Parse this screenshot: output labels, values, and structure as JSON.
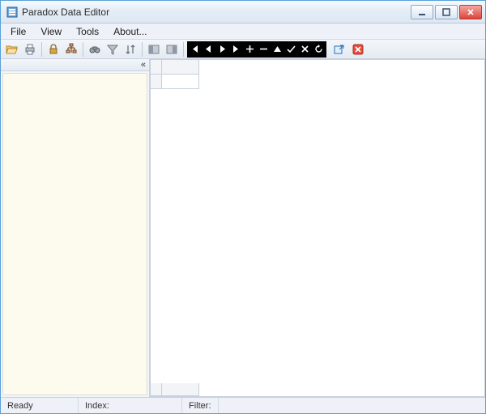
{
  "window": {
    "title": "Paradox Data Editor"
  },
  "menu": {
    "file": "File",
    "view": "View",
    "tools": "Tools",
    "about": "About..."
  },
  "toolbar": {
    "open": "open",
    "print": "print",
    "lock": "lock",
    "structure": "structure",
    "find": "find",
    "filter": "filter",
    "sort": "sort",
    "panel_a": "panel-a",
    "panel_b": "panel-b"
  },
  "nav": {
    "first": "first",
    "prior": "prior",
    "next": "next",
    "last": "last",
    "insert": "insert",
    "delete": "delete",
    "edit": "edit",
    "post": "post",
    "cancel": "cancel",
    "refresh": "refresh"
  },
  "extra": {
    "export": "export",
    "delete_all": "delete-all"
  },
  "side": {
    "collapse": "«"
  },
  "status": {
    "ready": "Ready",
    "index": "Index:",
    "filter": "Filter:"
  }
}
